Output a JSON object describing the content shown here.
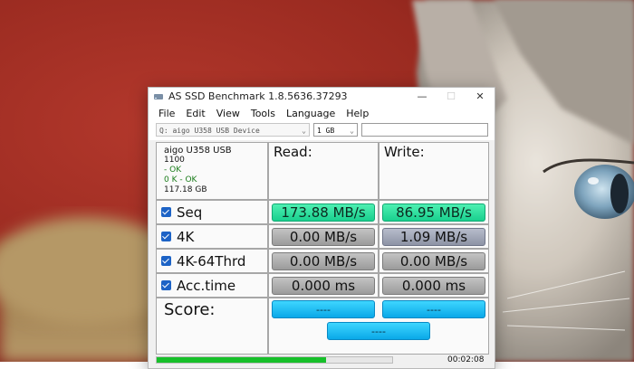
{
  "window": {
    "title": "AS SSD Benchmark 1.8.5636.37293",
    "controls": {
      "minimize": "—",
      "maximize": "☐",
      "close": "✕"
    }
  },
  "menu": [
    "File",
    "Edit",
    "View",
    "Tools",
    "Language",
    "Help"
  ],
  "toolbar": {
    "drive": "Q: aigo U358 USB Device",
    "size": "1 GB"
  },
  "device_info": {
    "name": "aigo U358 USB",
    "firmware": "1100",
    "driver": " - OK",
    "alignment": "0 K - OK",
    "capacity": "117.18 GB"
  },
  "headers": {
    "read": "Read:",
    "write": "Write:"
  },
  "tests": [
    {
      "label": "Seq",
      "read": "173.88 MB/s",
      "write": "86.95 MB/s",
      "read_style": "green",
      "write_style": "green"
    },
    {
      "label": "4K",
      "read": "0.00 MB/s",
      "write": "1.09 MB/s",
      "read_style": "grey",
      "write_style": "slate"
    },
    {
      "label": "4K-64Thrd",
      "read": "0.00 MB/s",
      "write": "0.00 MB/s",
      "read_style": "grey",
      "write_style": "grey"
    },
    {
      "label": "Acc.time",
      "read": "0.000 ms",
      "write": "0.000 ms",
      "read_style": "grey",
      "write_style": "grey"
    }
  ],
  "score": {
    "label": "Score:",
    "read": "----",
    "write": "----",
    "total": "----"
  },
  "progress": {
    "fraction": 0.72,
    "elapsed": "00:02:08"
  },
  "colors": {
    "accent_green": "#19cf8e",
    "score_blue": "#0aa8e8",
    "checkbox_blue": "#1d63c6"
  }
}
